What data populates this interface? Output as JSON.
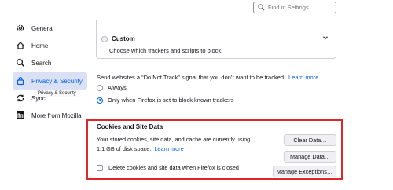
{
  "search": {
    "placeholder": "Find in Settings",
    "value": ""
  },
  "sidebar": {
    "items": [
      {
        "label": "General",
        "icon": "gear-icon"
      },
      {
        "label": "Home",
        "icon": "home-icon"
      },
      {
        "label": "Search",
        "icon": "search-icon"
      },
      {
        "label": "Privacy & Security",
        "icon": "lock-icon",
        "selected": true
      },
      {
        "label": "Sync",
        "icon": "sync-icon"
      },
      {
        "label": "More from Mozilla",
        "icon": "mozilla-icon"
      }
    ],
    "tooltip": "Privacy & Security"
  },
  "tracking": {
    "custom_label": "Custom",
    "custom_description": "Choose which trackers and scripts to block."
  },
  "dnt": {
    "description": "Send websites a “Do Not Track” signal that you don’t want to be tracked",
    "learn_more": "Learn more",
    "options": [
      {
        "label": "Always",
        "checked": false
      },
      {
        "label": "Only when Firefox is set to block known trackers",
        "checked": true
      }
    ]
  },
  "cookies": {
    "heading": "Cookies and Site Data",
    "description": "Your stored cookies, site data, and cache are currently using 1.1 GB of disk space.",
    "learn_more": "Learn more",
    "delete_label": "Delete cookies and site data when Firefox is closed",
    "delete_checked": false,
    "buttons": {
      "clear": "Clear Data…",
      "manage": "Manage Data…",
      "exceptions": "Manage Exceptions…"
    }
  },
  "colors": {
    "accent": "#0061e0",
    "highlight": "#e0262d",
    "selected_bg": "#dbe1f5"
  }
}
